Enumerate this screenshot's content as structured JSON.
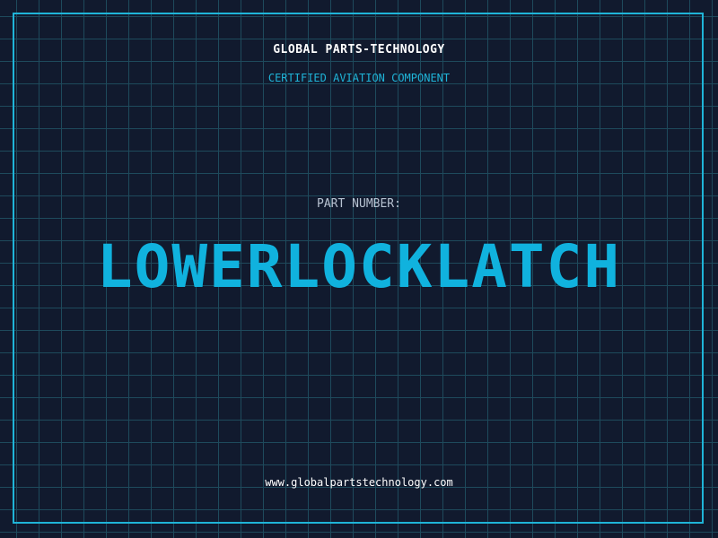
{
  "header": {
    "company": "GLOBAL PARTS-TECHNOLOGY",
    "tagline": "CERTIFIED AVIATION COMPONENT"
  },
  "part": {
    "label": "PART NUMBER:",
    "number": "LOWERLOCKLATCH"
  },
  "footer": {
    "website": "www.globalpartstechnology.com"
  },
  "colors": {
    "background": "#111a2e",
    "accent": "#1fb4d8",
    "grid": "#1e4a5c",
    "text": "#ffffff"
  }
}
